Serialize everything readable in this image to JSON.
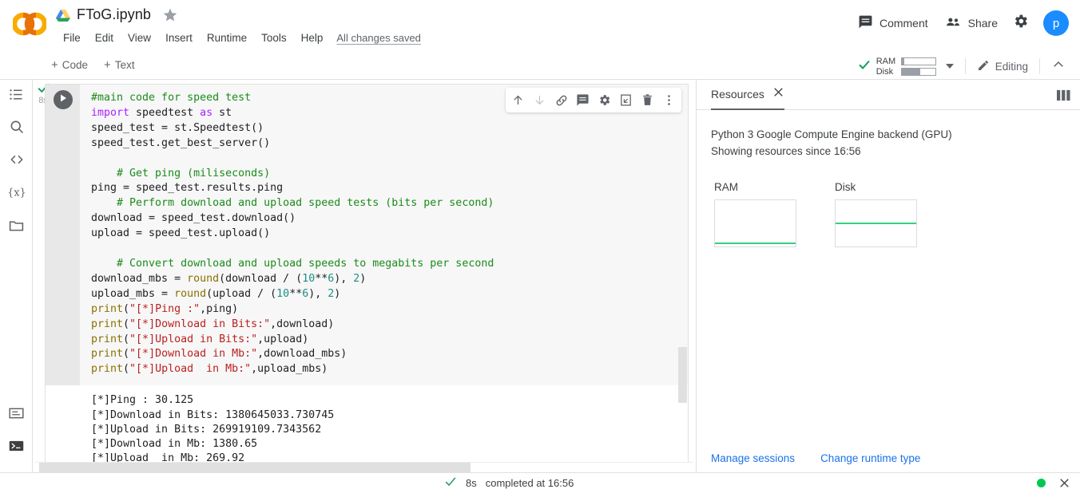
{
  "header": {
    "logo": "colab-logo",
    "drive_icon": "google-drive-icon",
    "doc_title": "FToG.ipynb",
    "star_icon": "star-icon",
    "menus": [
      "File",
      "Edit",
      "View",
      "Insert",
      "Runtime",
      "Tools",
      "Help"
    ],
    "save_status": "All changes saved",
    "comment_label": "Comment",
    "comment_icon": "comment-icon",
    "share_label": "Share",
    "share_icon": "people-icon",
    "settings_icon": "gear-icon",
    "avatar_initial": "p",
    "avatar_color": "#1a8cff"
  },
  "toolbar": {
    "add_code_label": "Code",
    "add_text_label": "Text",
    "plus": "+",
    "connected_icon": "checkmark-icon",
    "ram_label": "RAM",
    "disk_label": "Disk",
    "ram_fill_percent": 8,
    "disk_fill_percent": 55,
    "dropdown_icon": "caret-down-icon",
    "editing_label": "Editing",
    "editing_icon": "pencil-icon",
    "collapse_icon": "chevron-up-icon"
  },
  "sidebar": {
    "items": [
      {
        "name": "table-of-contents",
        "icon": "list-icon"
      },
      {
        "name": "find-and-replace",
        "icon": "search-icon"
      },
      {
        "name": "code-snippets",
        "icon": "code-brackets-icon"
      },
      {
        "name": "variables",
        "icon": "curly-x-icon"
      },
      {
        "name": "files",
        "icon": "folder-icon"
      }
    ],
    "bottom_items": [
      {
        "name": "command-palette",
        "icon": "command-palette-icon"
      },
      {
        "name": "terminal",
        "icon": "terminal-icon"
      }
    ]
  },
  "cell": {
    "status_check": "check",
    "status_time": "8s",
    "run_icon": "play-icon",
    "toolbar_icons": [
      {
        "name": "move-cell-up-icon",
        "glyph": "arrow-up"
      },
      {
        "name": "move-cell-down-icon",
        "glyph": "arrow-down"
      },
      {
        "name": "link-to-cell-icon",
        "glyph": "link"
      },
      {
        "name": "add-comment-icon",
        "glyph": "comment"
      },
      {
        "name": "cell-settings-icon",
        "glyph": "gear"
      },
      {
        "name": "mirror-cell-icon",
        "glyph": "open-in-new"
      },
      {
        "name": "delete-cell-icon",
        "glyph": "trash"
      },
      {
        "name": "more-cell-actions-icon",
        "glyph": "more-vert"
      }
    ],
    "code_lines": [
      [
        {
          "t": "#main code for speed test",
          "c": "c"
        }
      ],
      [
        {
          "t": "import ",
          "c": "k"
        },
        {
          "t": "speedtest ",
          "c": ""
        },
        {
          "t": "as ",
          "c": "k"
        },
        {
          "t": "st",
          "c": ""
        }
      ],
      [
        {
          "t": "speed_test = st.Speedtest()",
          "c": ""
        }
      ],
      [
        {
          "t": "speed_test.get_best_server()",
          "c": ""
        }
      ],
      [
        {
          "t": "",
          "c": ""
        }
      ],
      [
        {
          "t": "    # Get ping (miliseconds)",
          "c": "c"
        }
      ],
      [
        {
          "t": "ping = speed_test.results.ping",
          "c": ""
        }
      ],
      [
        {
          "t": "    # Perform download and upload speed tests (bits per second)",
          "c": "c"
        }
      ],
      [
        {
          "t": "download = speed_test.download()",
          "c": ""
        }
      ],
      [
        {
          "t": "upload = speed_test.upload()",
          "c": ""
        }
      ],
      [
        {
          "t": "",
          "c": ""
        }
      ],
      [
        {
          "t": "    # Convert download and upload speeds to megabits per second",
          "c": "c"
        }
      ],
      [
        {
          "t": "download_mbs = ",
          "c": ""
        },
        {
          "t": "round",
          "c": "b"
        },
        {
          "t": "(download / (",
          "c": ""
        },
        {
          "t": "10",
          "c": "n"
        },
        {
          "t": "**",
          "c": ""
        },
        {
          "t": "6",
          "c": "n"
        },
        {
          "t": "), ",
          "c": ""
        },
        {
          "t": "2",
          "c": "n"
        },
        {
          "t": ")",
          "c": ""
        }
      ],
      [
        {
          "t": "upload_mbs = ",
          "c": ""
        },
        {
          "t": "round",
          "c": "b"
        },
        {
          "t": "(upload / (",
          "c": ""
        },
        {
          "t": "10",
          "c": "n"
        },
        {
          "t": "**",
          "c": ""
        },
        {
          "t": "6",
          "c": "n"
        },
        {
          "t": "), ",
          "c": ""
        },
        {
          "t": "2",
          "c": "n"
        },
        {
          "t": ")",
          "c": ""
        }
      ],
      [
        {
          "t": "print",
          "c": "b"
        },
        {
          "t": "(",
          "c": ""
        },
        {
          "t": "\"[*]Ping :\"",
          "c": "s"
        },
        {
          "t": ",ping)",
          "c": ""
        }
      ],
      [
        {
          "t": "print",
          "c": "b"
        },
        {
          "t": "(",
          "c": ""
        },
        {
          "t": "\"[*]Download in Bits:\"",
          "c": "s"
        },
        {
          "t": ",download)",
          "c": ""
        }
      ],
      [
        {
          "t": "print",
          "c": "b"
        },
        {
          "t": "(",
          "c": ""
        },
        {
          "t": "\"[*]Upload in Bits:\"",
          "c": "s"
        },
        {
          "t": ",upload)",
          "c": ""
        }
      ],
      [
        {
          "t": "print",
          "c": "b"
        },
        {
          "t": "(",
          "c": ""
        },
        {
          "t": "\"[*]Download in Mb:\"",
          "c": "s"
        },
        {
          "t": ",download_mbs)",
          "c": ""
        }
      ],
      [
        {
          "t": "print",
          "c": "b"
        },
        {
          "t": "(",
          "c": ""
        },
        {
          "t": "\"[*]Upload  in Mb:\"",
          "c": "s"
        },
        {
          "t": ",upload_mbs)",
          "c": ""
        }
      ]
    ],
    "output_text": "[*]Ping : 30.125\n[*]Download in Bits: 1380645033.730745\n[*]Upload in Bits: 269919109.7343562\n[*]Download in Mb: 1380.65\n[*]Upload  in Mb: 269.92"
  },
  "resources": {
    "tab_label": "Resources",
    "close_icon": "close-icon",
    "panel_layout_icon": "panel-columns-icon",
    "backend_text": "Python 3 Google Compute Engine backend (GPU)",
    "since_text": "Showing resources since 16:56",
    "charts": [
      {
        "title": "RAM",
        "line_position_percent": 92,
        "line_color": "#34d17e"
      },
      {
        "title": "Disk",
        "line_position_percent": 48,
        "line_color": "#34d17e"
      }
    ],
    "manage_sessions_label": "Manage sessions",
    "change_runtime_label": "Change runtime type"
  },
  "statusbar": {
    "check_icon": "checkmark-icon",
    "duration": "8s",
    "completed_text": "completed at 16:56",
    "connection_dot_color": "#00c853",
    "close_icon": "close-icon"
  }
}
